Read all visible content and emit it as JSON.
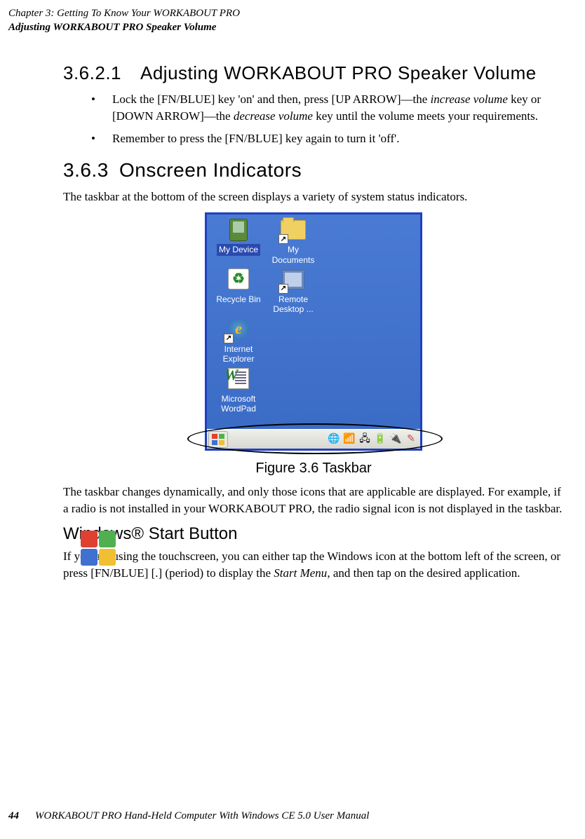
{
  "header": {
    "line1": "Chapter 3: Getting To Know Your WORKABOUT PRO",
    "line2": "Adjusting WORKABOUT PRO Speaker Volume"
  },
  "section_36_2_1": {
    "num": "3.6.2.1",
    "title": "Adjusting WORKABOUT PRO Speaker Volume",
    "bullet1_a": "Lock the [FN/BLUE] key 'on' and then, press [UP ARROW]—the ",
    "bullet1_em1": "increase volume",
    "bullet1_b": " key or [DOWN ARROW]—the ",
    "bullet1_em2": "decrease volume",
    "bullet1_c": " key until the volume meets your requirements.",
    "bullet2": "Remember to press the [FN/BLUE] key again to turn it 'off'."
  },
  "section_36_3": {
    "num": "3.6.3",
    "title": "Onscreen Indicators",
    "intro": "The taskbar at the bottom of the screen displays a variety of system status indicators."
  },
  "figure_caption": "Figure 3.6 Taskbar",
  "post_figure_para": "The taskbar changes dynamically, and only those icons that are applicable are displayed. For example, if a radio is not installed in your WORKABOUT PRO, the radio signal icon is not displayed in the taskbar.",
  "windows_start": {
    "title": "Windows® Start Button",
    "para_a": "If you are using the touchscreen, you can either tap the Windows icon at the bottom left of the screen, or press [FN/BLUE] [.] (period) to display the ",
    "para_em": "Start Menu",
    "para_b": ", and then tap on the desired application."
  },
  "desktop": {
    "my_device": "My Device",
    "my_documents_l1": "My",
    "my_documents_l2": "Documents",
    "recycle_bin": "Recycle Bin",
    "remote_l1": "Remote",
    "remote_l2": "Desktop ...",
    "ie_l1": "Internet",
    "ie_l2": "Explorer",
    "wp_l1": "Microsoft",
    "wp_l2": "WordPad"
  },
  "footer": {
    "page": "44",
    "text": "WORKABOUT PRO Hand-Held Computer With Windows CE 5.0 User Manual"
  }
}
